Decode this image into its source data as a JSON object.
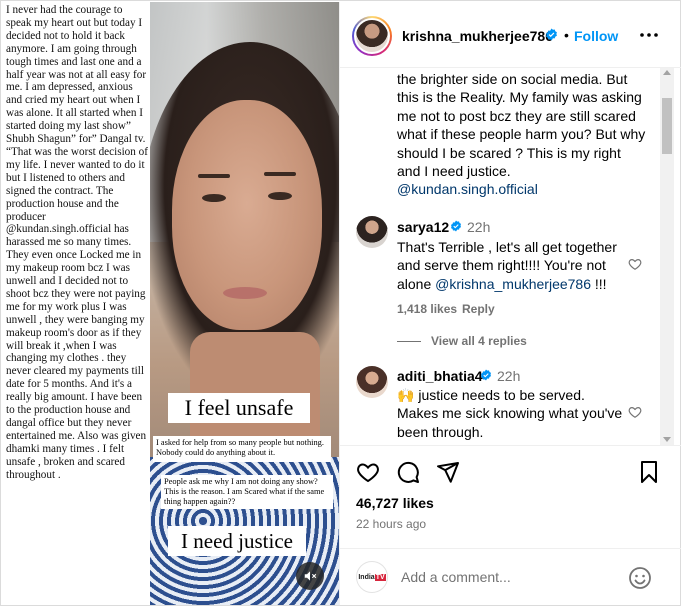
{
  "media": {
    "side_text": "I never had the courage to speak my heart out but today I decided not to hold it back anymore. I am going through tough times and last one and a half year was not at all easy for me. I am depressed, anxious and cried my heart out when I was alone. It all started when I started doing my last show” Shubh Shagun” for” Dangal tv. “That was the worst decision of my life. I never wanted to do it but I listened to others and signed the contract. The production house and the producer @kundan.singh.official has harassed me so many times. They even once Locked me in my makeup room bcz I was unwell and I decided not to shoot bcz they were not paying me for my work plus I was unwell , they were banging my makeup room's door as if they will break it ,when I was changing my clothes . they never cleared my payments till date for 5 months. And it's a really big amount. I have been to the production house and dangal office but they never entertained me. Also was given dhamki many times . I felt unsafe , broken and scared throughout .",
    "overlay_unsafe": "I feel unsafe",
    "overlay_help": "I asked for help from so many people but nothing. Nobody could do anything about it.",
    "overlay_ask": "People ask me why I am not doing any show? This is the reason. I am Scared what if the same thing happen again??",
    "overlay_justice": "I need justice",
    "mute_icon": "speaker-muted-icon"
  },
  "header": {
    "username": "krishna_mukherjee786",
    "separator": "•",
    "follow_label": "Follow",
    "verified_color": "#0095f6"
  },
  "caption": {
    "text_before": "the brighter side on social media. But this is the Reality. My family was asking me not to post bcz they are still scared what if these people harm you? But why should I be scared ? This is my right and I need justice.",
    "mention": "@kundan.singh.official"
  },
  "comments": [
    {
      "username": "sarya12",
      "time": "22h",
      "text_before": "That's Terrible , let's all get together and serve them right!!!! You're not alone",
      "mention": "@krishna_mukherjee786",
      "text_after": "!!!",
      "likes": "1,418 likes",
      "reply_label": "Reply",
      "view_replies": "View all 4 replies"
    },
    {
      "username": "aditi_bhatia4",
      "time": "22h",
      "emoji": "🙌",
      "text": " justice needs to be served. Makes me sick knowing what you've been through."
    }
  ],
  "stats": {
    "likes": "46,727 likes",
    "time_ago": "22 hours ago"
  },
  "add_comment": {
    "placeholder": "Add a comment...",
    "viewer_badge_1": "India",
    "viewer_badge_2": "TV"
  },
  "colors": {
    "accent": "#0095f6",
    "mention": "#00376b",
    "secondary_text": "#737373"
  }
}
